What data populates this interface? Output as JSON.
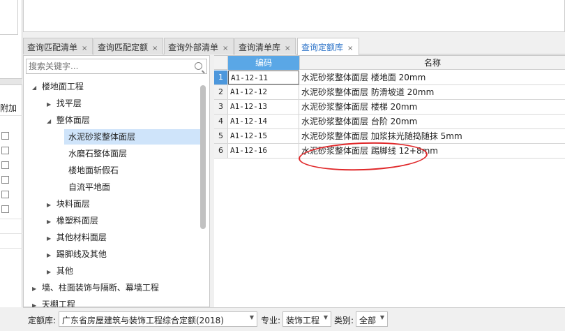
{
  "left_strip": {
    "label": "附加"
  },
  "tabs": [
    {
      "label": "查询匹配清单",
      "active": false
    },
    {
      "label": "查询匹配定额",
      "active": false
    },
    {
      "label": "查询外部清单",
      "active": false
    },
    {
      "label": "查询清单库",
      "active": false
    },
    {
      "label": "查询定额库",
      "active": true
    }
  ],
  "tab_close": "×",
  "search": {
    "placeholder": "搜索关键字..."
  },
  "tree": [
    {
      "label": "楼地面工程",
      "level": 0,
      "arrow": "◢"
    },
    {
      "label": "找平层",
      "level": 1,
      "arrow": "▶"
    },
    {
      "label": "整体面层",
      "level": 1,
      "arrow": "◢"
    },
    {
      "label": "水泥砂浆整体面层",
      "level": 2,
      "arrow": "",
      "selected": true
    },
    {
      "label": "水磨石整体面层",
      "level": 2,
      "arrow": ""
    },
    {
      "label": "楼地面斩假石",
      "level": 2,
      "arrow": ""
    },
    {
      "label": "自流平地面",
      "level": 2,
      "arrow": ""
    },
    {
      "label": "块料面层",
      "level": 1,
      "arrow": "▶"
    },
    {
      "label": "橡塑料面层",
      "level": 1,
      "arrow": "▶"
    },
    {
      "label": "其他材料面层",
      "level": 1,
      "arrow": "▶"
    },
    {
      "label": "踢脚线及其他",
      "level": 1,
      "arrow": "▶"
    },
    {
      "label": "其他",
      "level": 1,
      "arrow": "▶"
    },
    {
      "label": "墙、柱面装饰与隔断、幕墙工程",
      "level": 0,
      "arrow": "▶"
    },
    {
      "label": "天棚工程",
      "level": 0,
      "arrow": "▶"
    }
  ],
  "grid": {
    "headers": {
      "code": "编码",
      "name": "名称"
    },
    "rows": [
      {
        "num": "1",
        "code": "A1-12-11",
        "name": "水泥砂浆整体面层 楼地面 20mm"
      },
      {
        "num": "2",
        "code": "A1-12-12",
        "name": "水泥砂浆整体面层 防滑坡道 20mm"
      },
      {
        "num": "3",
        "code": "A1-12-13",
        "name": "水泥砂浆整体面层 楼梯 20mm"
      },
      {
        "num": "4",
        "code": "A1-12-14",
        "name": "水泥砂浆整体面层 台阶 20mm"
      },
      {
        "num": "5",
        "code": "A1-12-15",
        "name": "水泥砂浆整体面层 加浆抹光随捣随抹 5mm"
      },
      {
        "num": "6",
        "code": "A1-12-16",
        "name": "水泥砂浆整体面层 踢脚线 12+8mm"
      }
    ]
  },
  "bottom": {
    "quota_label": "定额库:",
    "quota_value": "广东省房屋建筑与装饰工程综合定额(2018)",
    "major_label": "专业:",
    "major_value": "装饰工程",
    "category_label": "类别:",
    "category_value": "全部"
  }
}
